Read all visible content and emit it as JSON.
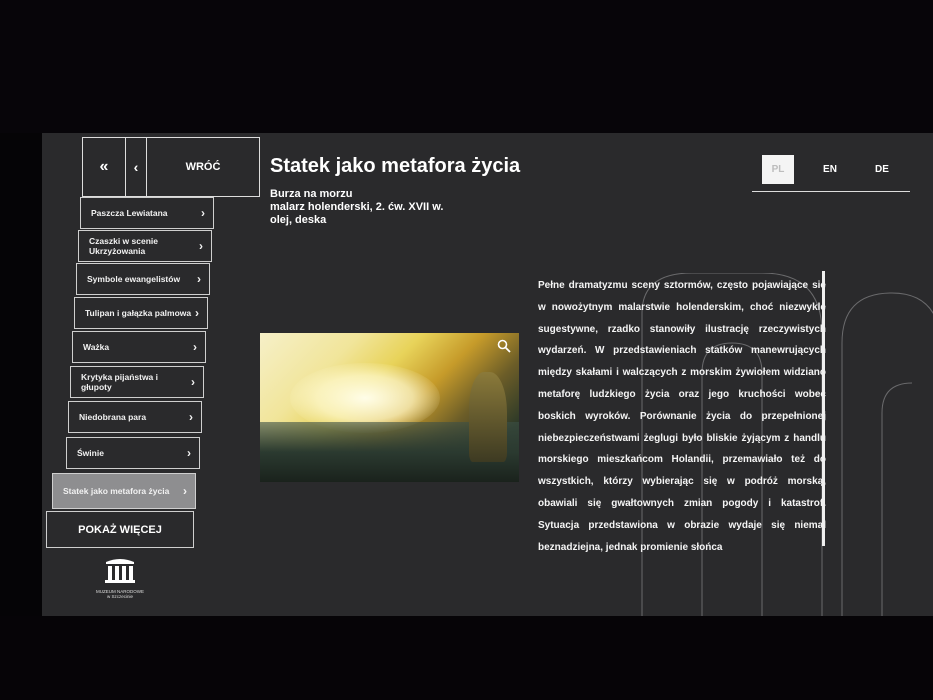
{
  "nav": {
    "double_back_icon": "«",
    "back_icon": "‹",
    "back_label": "WRÓĆ",
    "items": [
      {
        "label": "Paszcza Lewiatana"
      },
      {
        "label": "Czaszki w scenie Ukrzyżowania"
      },
      {
        "label": "Symbole ewangelistów"
      },
      {
        "label": "Tulipan i gałązka palmowa"
      },
      {
        "label": "Ważka"
      },
      {
        "label": "Krytyka pijaństwa i głupoty"
      },
      {
        "label": "Niedobrana para"
      },
      {
        "label": "Świnie"
      },
      {
        "label": "Statek jako metafora życia",
        "active": true
      }
    ],
    "chevron": "›",
    "more_label": "POKAŻ WIĘCEJ"
  },
  "logo": {
    "text_line1": "MUZEUM NARODOWE",
    "text_line2": "w Szczecinie"
  },
  "header": {
    "title": "Statek jako metafora życia",
    "subtitle_line1": "Burza na morzu",
    "subtitle_line2": "malarz holenderski, 2. ćw. XVII w.",
    "subtitle_line3": "olej, deska"
  },
  "languages": [
    {
      "code": "PL",
      "active": true
    },
    {
      "code": "EN"
    },
    {
      "code": "DE"
    }
  ],
  "description": "Pełne dramatyzmu sceny sztormów, często pojawiające się w nowożytnym malarstwie holenderskim, choć niezwykle sugestywne, rzadko stanowiły ilustrację rzeczywistych wydarzeń. W przedstawieniach statków manewrujących między skałami i walczących z morskim żywiołem widziano metaforę ludzkiego życia oraz jego kruchości wobec boskich wyroków. Porównanie życia do przepełnionej niebezpieczeństwami żeglugi było bliskie żyjącym z handlu morskiego mieszkańcom Holandii, przemawiało też do wszystkich, którzy wybierając się w podróż morską, obawiali się gwałtownych zmian pogody i katastrof. Sytuacja przedstawiona w obrazie wydaje się niemal beznadziejna, jednak promienie słońca",
  "icons": {
    "zoom": "zoom-icon"
  },
  "colors": {
    "screen_bg": "#2a2a2c",
    "active_item_bg": "#8e8e90",
    "lang_active_bg": "#f4f4f4"
  }
}
